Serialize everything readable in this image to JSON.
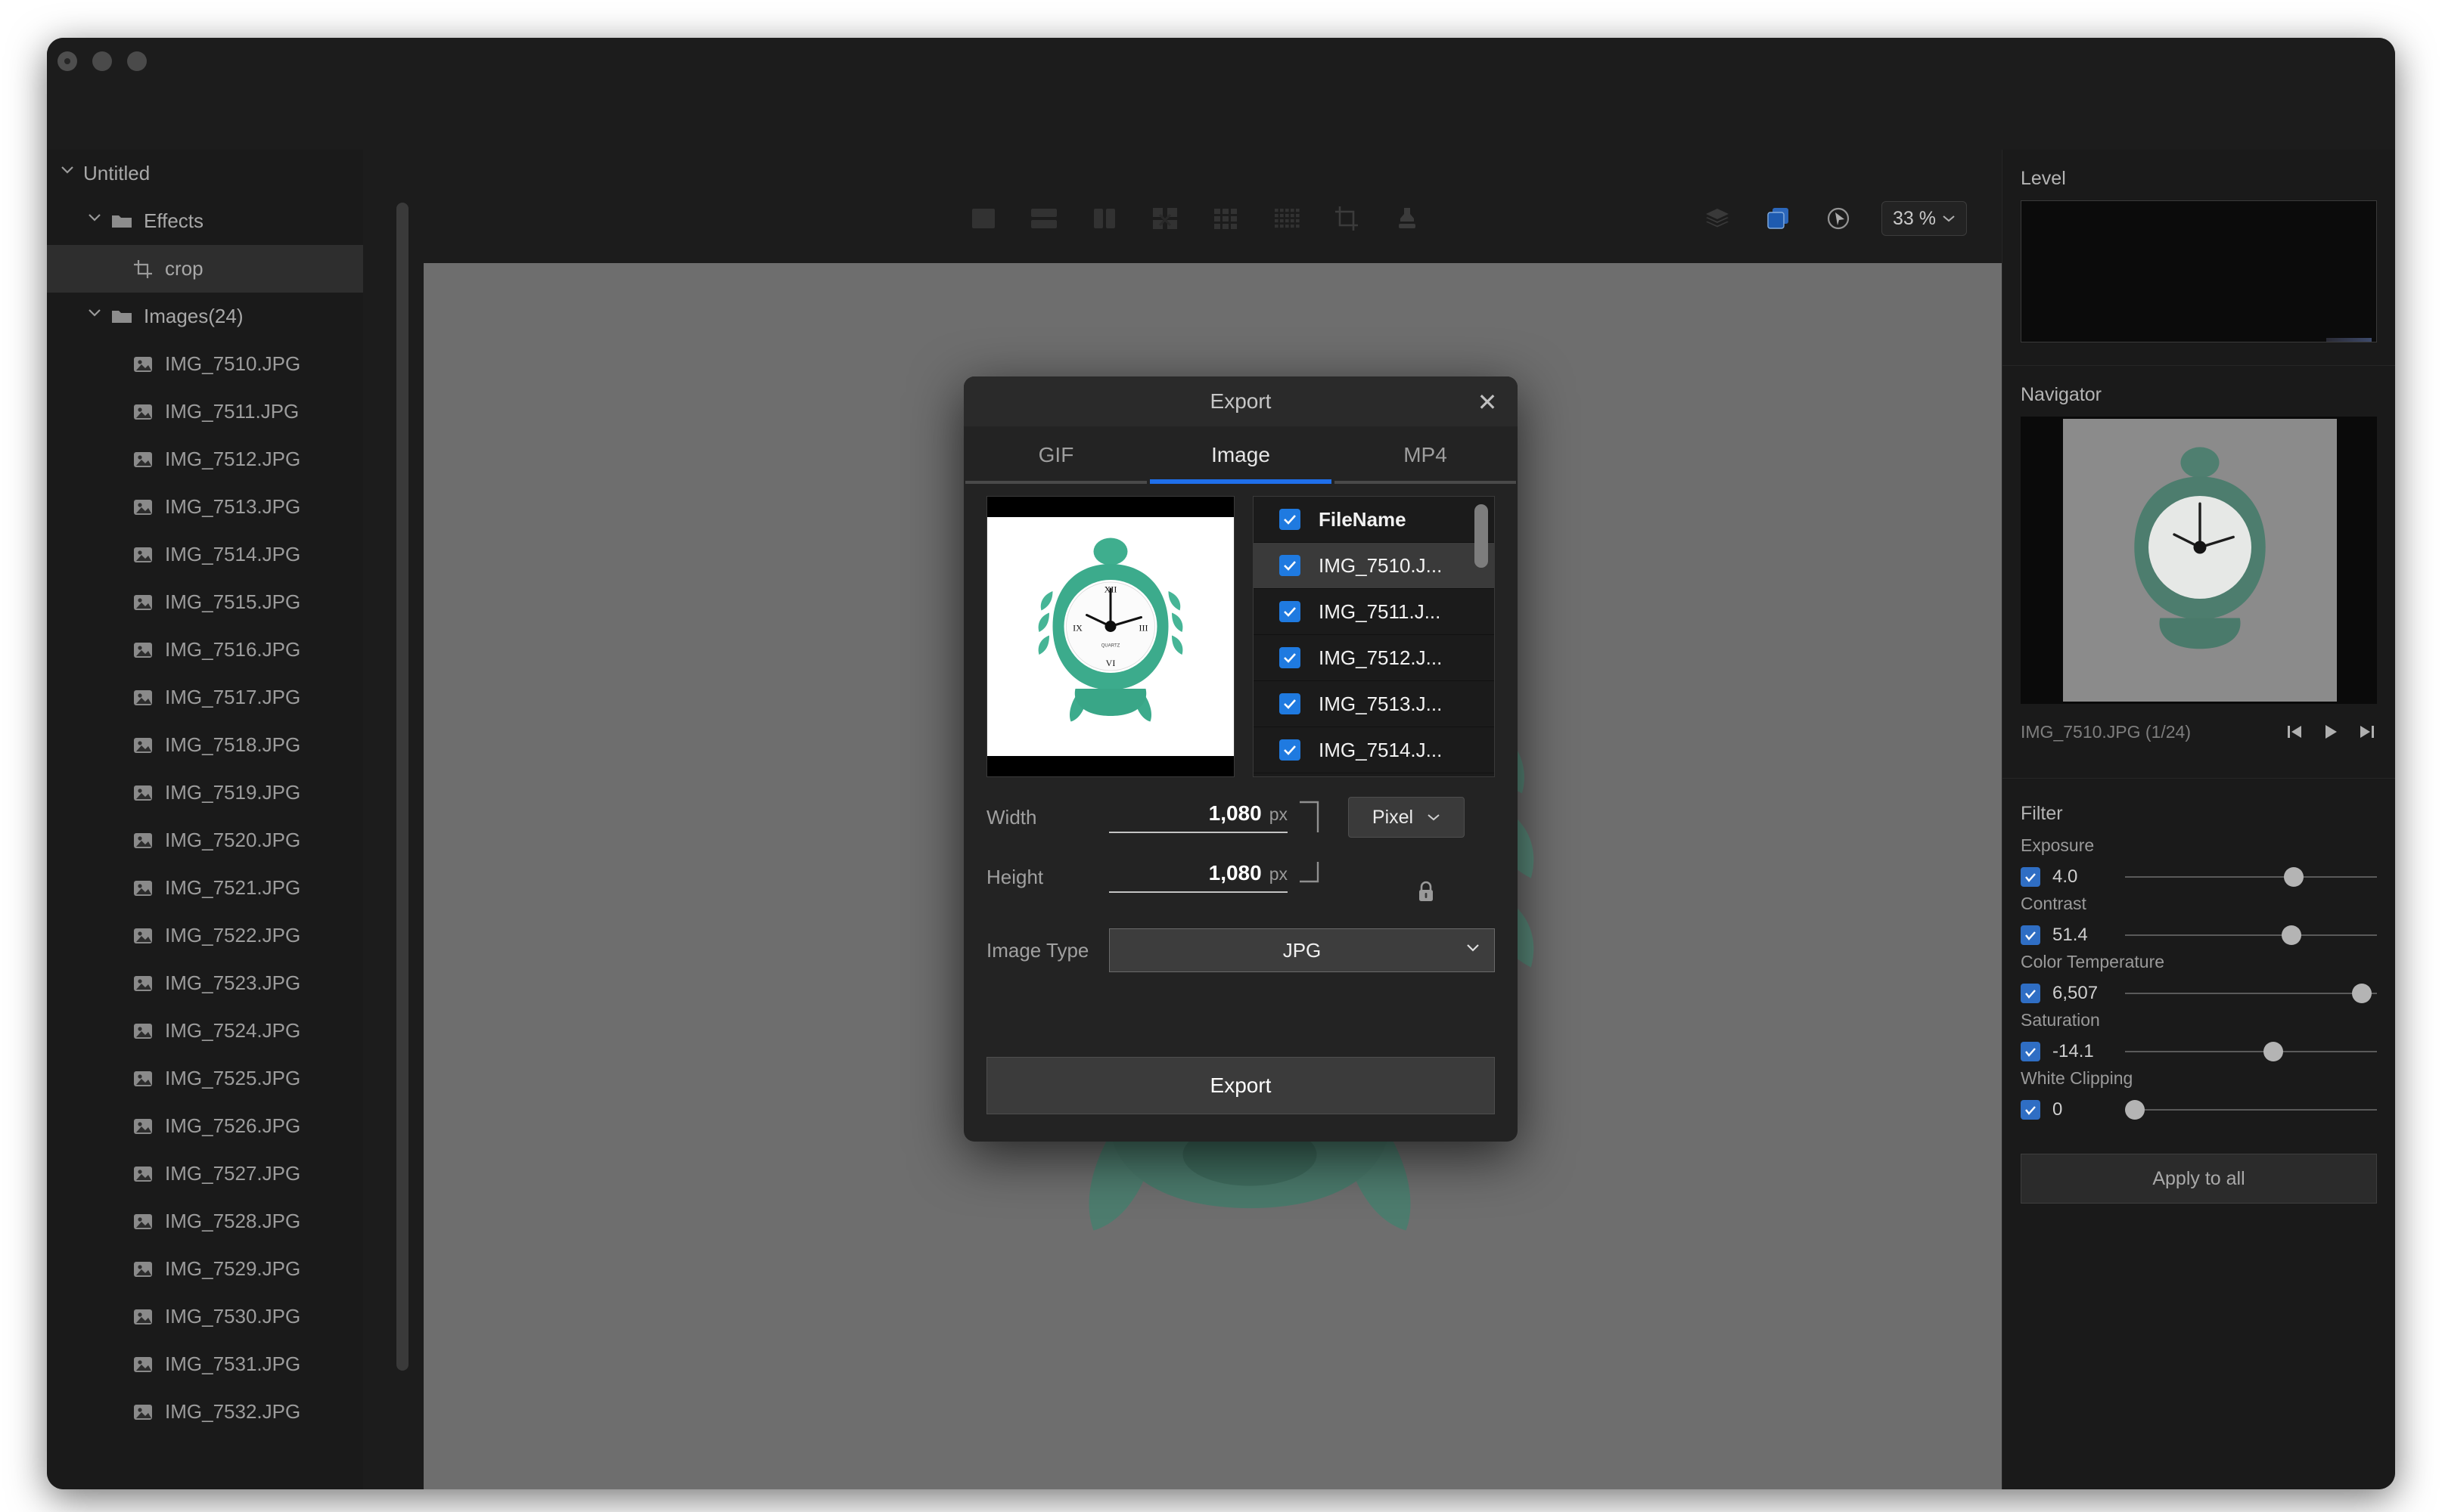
{
  "window": {
    "traffic_lights": [
      "close",
      "minimize",
      "maximize"
    ]
  },
  "sidebar": {
    "project": {
      "label": "Untitled",
      "expanded": true
    },
    "groups": [
      {
        "label": "Effects",
        "icon": "folder-icon",
        "expanded": true,
        "children": [
          {
            "label": "crop",
            "icon": "crop-icon",
            "selected": true
          }
        ]
      },
      {
        "label": "Images(24)",
        "icon": "folder-icon",
        "expanded": true
      }
    ],
    "files": [
      "IMG_7510.JPG",
      "IMG_7511.JPG",
      "IMG_7512.JPG",
      "IMG_7513.JPG",
      "IMG_7514.JPG",
      "IMG_7515.JPG",
      "IMG_7516.JPG",
      "IMG_7517.JPG",
      "IMG_7518.JPG",
      "IMG_7519.JPG",
      "IMG_7520.JPG",
      "IMG_7521.JPG",
      "IMG_7522.JPG",
      "IMG_7523.JPG",
      "IMG_7524.JPG",
      "IMG_7525.JPG",
      "IMG_7526.JPG",
      "IMG_7527.JPG",
      "IMG_7528.JPG",
      "IMG_7529.JPG",
      "IMG_7530.JPG",
      "IMG_7531.JPG",
      "IMG_7532.JPG"
    ]
  },
  "toolbar": {
    "left_tools": [
      "single-view-icon",
      "split-horizontal-icon",
      "split-vertical-icon",
      "compare-icon",
      "grid-3x3-icon",
      "grid-dense-icon",
      "crop-tool-icon",
      "stamp-tool-icon"
    ],
    "right_tools": [
      "layers-icon",
      "duplicate-icon",
      "cursor-icon"
    ],
    "zoom": {
      "value": "33 %",
      "icon": "chevron-down-icon"
    }
  },
  "right_panel": {
    "level": {
      "title": "Level"
    },
    "navigator": {
      "title": "Navigator",
      "filename": "IMG_7510.JPG (1/24)",
      "controls": [
        "skip-back-icon",
        "play-icon",
        "skip-forward-icon"
      ]
    },
    "filter": {
      "title": "Filter",
      "items": [
        {
          "label": "Exposure",
          "value": "4.0",
          "checked": true,
          "knob_pct": 67
        },
        {
          "label": "Contrast",
          "value": "51.4",
          "checked": true,
          "knob_pct": 66
        },
        {
          "label": "Color Temperature",
          "value": "6,507",
          "checked": true,
          "knob_pct": 94
        },
        {
          "label": "Saturation",
          "value": "-14.1",
          "checked": true,
          "knob_pct": 59
        },
        {
          "label": "White Clipping",
          "value": "0",
          "checked": true,
          "knob_pct": 4
        }
      ],
      "apply_all_label": "Apply to all"
    }
  },
  "export_dialog": {
    "title": "Export",
    "close_icon": "close-icon",
    "tabs": [
      {
        "label": "GIF",
        "active": false
      },
      {
        "label": "Image",
        "active": true
      },
      {
        "label": "MP4",
        "active": false
      }
    ],
    "file_list": {
      "header": {
        "label": "FileName",
        "checked": true
      },
      "rows": [
        {
          "label": "IMG_7510.J...",
          "checked": true,
          "selected": true
        },
        {
          "label": "IMG_7511.J...",
          "checked": true,
          "selected": false
        },
        {
          "label": "IMG_7512.J...",
          "checked": true,
          "selected": false
        },
        {
          "label": "IMG_7513.J...",
          "checked": true,
          "selected": false
        },
        {
          "label": "IMG_7514.J...",
          "checked": true,
          "selected": false
        }
      ]
    },
    "form": {
      "width_label": "Width",
      "width_value": "1,080",
      "width_unit": "px",
      "height_label": "Height",
      "height_value": "1,080",
      "height_unit": "px",
      "lock_icon": "lock-icon",
      "unit_value": "Pixel",
      "unit_caret": "chevron-down-icon",
      "image_type_label": "Image Type",
      "image_type_value": "JPG",
      "image_type_caret": "chevron-down-icon"
    },
    "export_button": "Export"
  },
  "colors": {
    "accent_blue": "#1f6feb",
    "checkbox_blue": "#1f7ae0",
    "canvas_gray": "#6e6e6e",
    "panel_bg": "#1a1a1a",
    "dialog_bg": "#232323"
  }
}
